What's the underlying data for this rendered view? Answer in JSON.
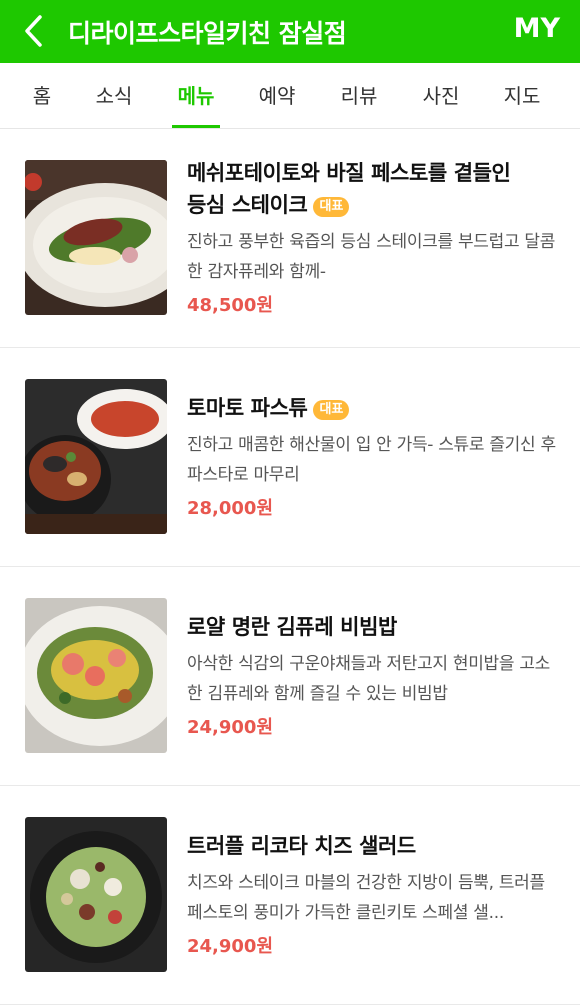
{
  "header": {
    "title": "디라이프스타일키친 잠실점",
    "my_label": "MY",
    "back_icon": "chevron-left-icon",
    "bg_color": "#1ec800"
  },
  "tabs": [
    {
      "label": "홈",
      "active": false
    },
    {
      "label": "소식",
      "active": false
    },
    {
      "label": "메뉴",
      "active": true
    },
    {
      "label": "예약",
      "active": false
    },
    {
      "label": "리뷰",
      "active": false
    },
    {
      "label": "사진",
      "active": false
    },
    {
      "label": "지도",
      "active": false
    }
  ],
  "menu": [
    {
      "name_line1": "메쉬포테이토와 바질 페스토를 곁들인",
      "name_line2": "등심 스테이크",
      "badge": "대표",
      "desc": "진하고 풍부한 육즙의 등심 스테이크를 부드럽고 달콤한 감자퓨레와 함께-",
      "price": "48,500원"
    },
    {
      "name_line1": "토마토 파스튜",
      "badge": "대표",
      "desc": "진하고 매콤한 해산물이 입 안 가득- 스튜로 즐기신 후 파스타로 마무리",
      "price": "28,000원"
    },
    {
      "name_line1": "로얄 명란 김퓨레 비빔밥",
      "desc": "아삭한 식감의 구운야채들과 저탄고지 현미밥을 고소한 김퓨레와 함께 즐길 수 있는 비빔밥",
      "price": "24,900원"
    },
    {
      "name_line1": "트러플 리코타 치즈 샐러드",
      "desc": "치즈와 스테이크 마블의 건강한 지방이 듬뿍, 트러플 페스토의 풍미가 가득한 클린키토 스페셜 샐...",
      "price": "24,900원"
    }
  ],
  "colors": {
    "accent": "#1ec800",
    "price": "#e8574f",
    "badge": "#ffb838"
  }
}
